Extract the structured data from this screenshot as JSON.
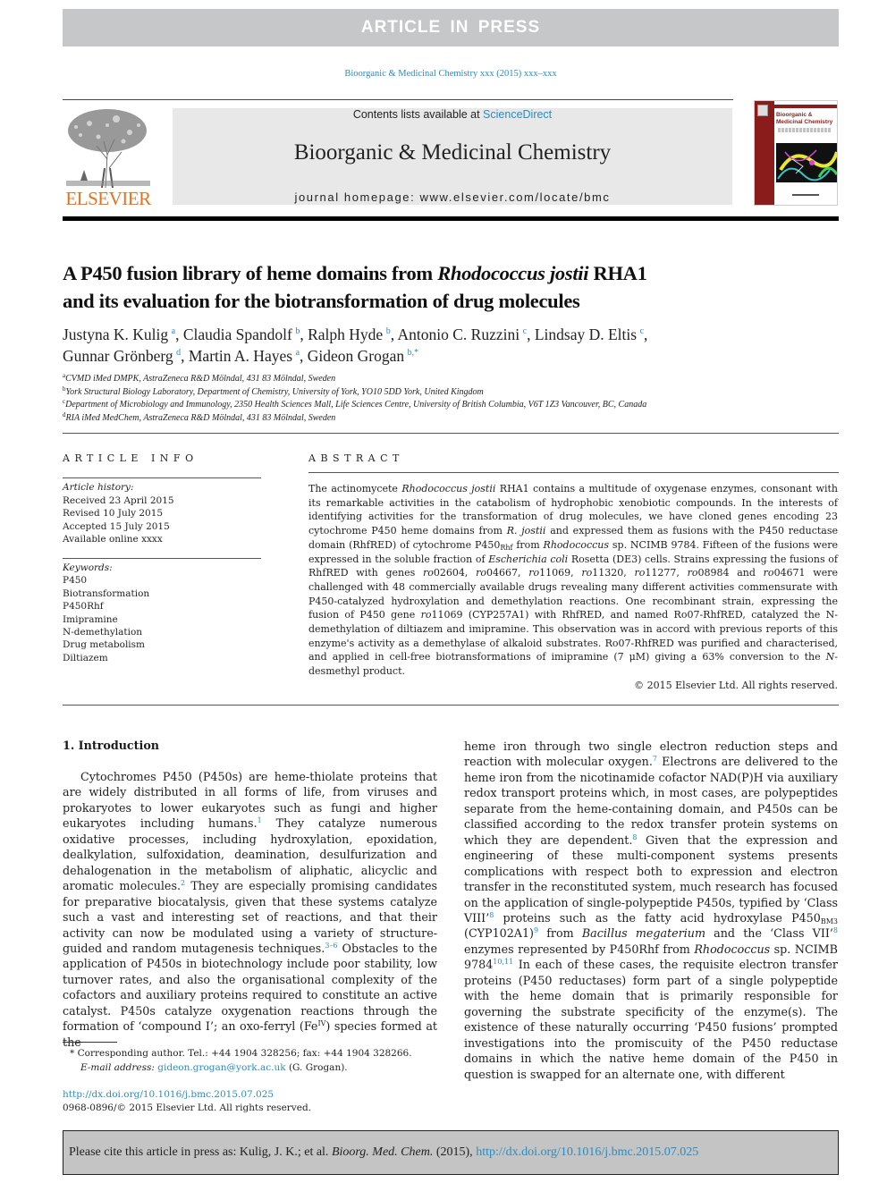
{
  "banner": {
    "text": "ARTICLE IN PRESS"
  },
  "journal_reference": "Bioorganic & Medicinal Chemistry xxx (2015) xxx–xxx",
  "header": {
    "publisher_logo": "ELSEVIER",
    "contents_prefix": "Contents lists available at ",
    "contents_link": "ScienceDirect",
    "journal_title": "Bioorganic & Medicinal Chemistry",
    "homepage": "journal homepage: www.elsevier.com/locate/bmc",
    "cover_title": "Bioorganic & Medicinal Chemistry",
    "colors": {
      "accent_link": "#2a8cc2",
      "elsevier_orange": "#e9711c",
      "cover_red": "#8b1c1c",
      "banner_gray": "#c6c7c8"
    }
  },
  "article": {
    "title_part1": "A P450 fusion library of heme domains from ",
    "title_italic": "Rhodococcus jostii",
    "title_part2": " RHA1",
    "title_line2": "and its evaluation for the biotransformation of drug molecules",
    "authors": [
      {
        "name": "Justyna K. Kulig",
        "aff": "a"
      },
      {
        "name": "Claudia Spandolf",
        "aff": "b"
      },
      {
        "name": "Ralph Hyde",
        "aff": "b"
      },
      {
        "name": "Antonio C. Ruzzini",
        "aff": "c"
      },
      {
        "name": "Lindsay D. Eltis",
        "aff": "c"
      },
      {
        "name": "Gunnar Grönberg",
        "aff": "d"
      },
      {
        "name": "Martin A. Hayes",
        "aff": "a"
      },
      {
        "name": "Gideon Grogan",
        "aff": "b,*"
      }
    ],
    "affiliations": [
      {
        "key": "a",
        "text": "CVMD iMed DMPK, AstraZeneca R&D Mölndal, 431 83 Mölndal, Sweden"
      },
      {
        "key": "b",
        "text": "York Structural Biology Laboratory, Department of Chemistry, University of York, YO10 5DD York, United Kingdom"
      },
      {
        "key": "c",
        "text": "Department of Microbiology and Immunology, 2350 Health Sciences Mall, Life Sciences Centre, University of British Columbia, V6T 1Z3 Vancouver, BC, Canada"
      },
      {
        "key": "d",
        "text": "RIA iMed MedChem, AstraZeneca R&D Mölndal, 431 83 Mölndal, Sweden"
      }
    ]
  },
  "article_info": {
    "heading": "ARTICLE INFO",
    "history_label": "Article history:",
    "history": [
      "Received 23 April 2015",
      "Revised 10 July 2015",
      "Accepted 15 July 2015",
      "Available online xxxx"
    ],
    "keywords_label": "Keywords:",
    "keywords": [
      "P450",
      "Biotransformation",
      "P450Rhf",
      "Imipramine",
      "N-demethylation",
      "Drug metabolism",
      "Diltiazem"
    ]
  },
  "abstract": {
    "heading": "ABSTRACT",
    "segments": {
      "s1": "The actinomycete ",
      "i1": "Rhodococcus jostii",
      "s2": " RHA1 contains a multitude of oxygenase enzymes, consonant with its remarkable activities in the catabolism of hydrophobic xenobiotic compounds. In the interests of identifying activities for the transformation of drug molecules, we have cloned genes encoding 23 cytochrome P450 heme domains from ",
      "i2": "R. jostii",
      "s3": " and expressed them as fusions with the P450 reductase domain (RhfRED) of cytochrome P450",
      "sub1": "Rhf",
      "s4": " from ",
      "i3": "Rhodococcus",
      "s5": " sp. NCIMB 9784. Fifteen of the fusions were expressed in the soluble fraction of ",
      "i4": "Escherichia coli",
      "s6": " Rosetta (DE3) cells. Strains expressing the fusions of RhfRED with genes ",
      "g1": "ro",
      "s7": "02604, ",
      "g2": "ro",
      "s8": "04667, ",
      "g3": "ro",
      "s9": "11069, ",
      "g4": "ro",
      "s10": "11320, ",
      "g5": "ro",
      "s11": "11277, ",
      "g6": "ro",
      "s12": "08984 and ",
      "g7": "ro",
      "s13": "04671 were challenged with 48 commercially available drugs revealing many different activities commensurate with P450-catalyzed hydroxylation and demethylation reactions. One recombinant strain, expressing the fusion of P450 gene ",
      "g8": "ro",
      "s14": "11069 (CYP257A1) with RhfRED, and named Ro07-RhfRED, catalyzed the N-demethylation of diltiazem and imipramine. This observation was in accord with previous reports of this enzyme's activity as a demethylase of alkaloid substrates. Ro07-RhfRED was purified and characterised, and applied in cell-free biotransformations of imipramine (7 μM) giving a 63% conversion to the ",
      "i5": "N",
      "s15": "-desmethyl product."
    },
    "copyright": "© 2015 Elsevier Ltd. All rights reserved."
  },
  "body": {
    "section_heading": "1. Introduction",
    "left": {
      "p1": "Cytochromes P450 (P450s) are heme-thiolate proteins that are widely distributed in all forms of life, from viruses and prokaryotes to lower eukaryotes such as fungi and higher eukaryotes including humans.",
      "r1": "1",
      "p2": " They catalyze numerous oxidative processes, including hydroxylation, epoxidation, dealkylation, sulfoxidation, deamination, desulfurization and dehalogenation in the metabolism of aliphatic, alicyclic and aromatic molecules.",
      "r2": "2",
      "p3": " They are especially promising candidates for preparative biocatalysis, given that these systems catalyze such a vast and interesting set of reactions, and that their activity can now be modulated using a variety of structure-guided and random mutagenesis techniques.",
      "r3": "3–6",
      "p4": " Obstacles to the application of P450s in biotechnology include poor stability, low turnover rates, and also the organisational complexity of the cofactors and auxiliary proteins required to constitute an active catalyst. P450s catalyze oxygenation reactions through the formation of ‘compound I’; an oxo-ferryl (Fe",
      "sup_iv": "IV",
      "p5": ") species formed at the"
    },
    "right": {
      "p1": "heme iron through two single electron reduction steps and reaction with molecular oxygen.",
      "r7": "7",
      "p2": " Electrons are delivered to the heme iron from the nicotinamide cofactor NAD(P)H via auxiliary redox transport proteins which, in most cases, are polypeptides separate from the heme-containing domain, and P450s can be classified according to the redox transfer protein systems on which they are dependent.",
      "r8a": "8",
      "p3": " Given that the expression and engineering of these multi-component systems presents complications with respect both to expression and electron transfer in the reconstituted system, much research has focused on the application of single-polypeptide P450s, typified by ‘Class VIII’",
      "r8b": "8",
      "p4": " proteins such as the fatty acid hydroxylase P450",
      "sub_bm3": "BM3",
      "p5": " (CYP102A1)",
      "r9": "9",
      "p6": " from ",
      "i_bac": "Bacillus megaterium",
      "p7": " and the ‘Class VII’",
      "r8c": "8",
      "p8": " enzymes represented by P450Rhf from ",
      "i_rho": "Rhodococcus",
      "p9": " sp. NCIMB 9784",
      "r10": "10,11",
      "p10": " In each of these cases, the requisite electron transfer proteins (P450 reductases) form part of a single polypeptide with the heme domain that is primarily responsible for governing the substrate specificity of the enzyme(s). The existence of these naturally occurring ‘P450 fusions’ prompted investigations into the promiscuity of the P450 reductase domains in which the native heme domain of the P450 in question is swapped for an alternate one, with different"
    }
  },
  "footnote": {
    "marker": "*",
    "corresponding": " Corresponding author. Tel.: +44 1904 328256; fax: +44 1904 328266.",
    "email_label": "E-mail address: ",
    "email": "gideon.grogan@york.ac.uk",
    "email_suffix": " (G. Grogan)."
  },
  "doi": {
    "link": "http://dx.doi.org/10.1016/j.bmc.2015.07.025",
    "issn_copyright": "0968-0896/© 2015 Elsevier Ltd. All rights reserved."
  },
  "citation_box": {
    "prefix": "Please cite this article in press as: Kulig, J. K.; et al. ",
    "journal_abbrev": "Bioorg. Med. Chem.",
    "year": " (2015), ",
    "link": "http://dx.doi.org/10.1016/j.bmc.2015.07.025"
  }
}
